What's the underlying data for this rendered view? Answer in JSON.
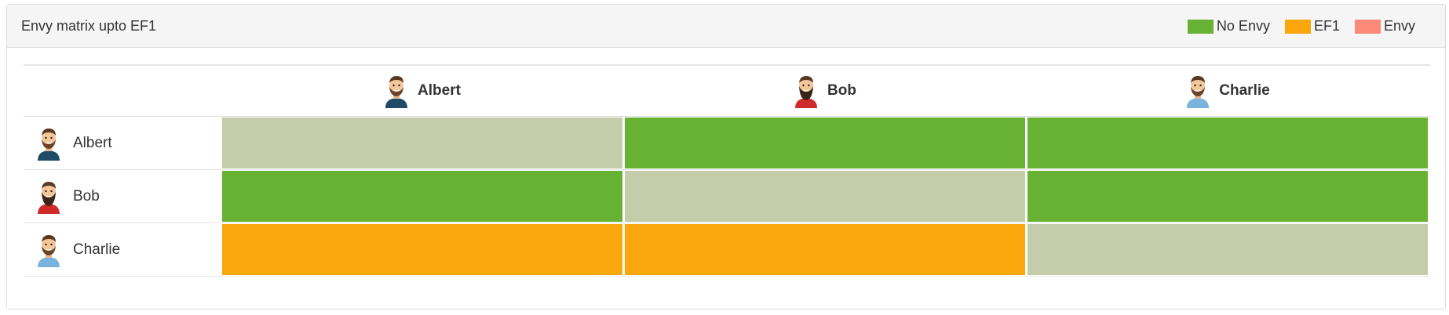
{
  "panel": {
    "title": "Envy matrix upto EF1"
  },
  "legend": [
    {
      "label": "No Envy",
      "color": "#67b133"
    },
    {
      "label": "EF1",
      "color": "#faa70d"
    },
    {
      "label": "Envy",
      "color": "#fb8a7a"
    }
  ],
  "colors": {
    "self": "#c4cca9",
    "no_envy": "#67b133",
    "ef1": "#faa70d",
    "envy": "#fb8a7a"
  },
  "agents": [
    {
      "name": "Albert",
      "avatar": "avatar-albert-icon",
      "shirt": "#1f4a68"
    },
    {
      "name": "Bob",
      "avatar": "avatar-bob-icon",
      "shirt": "#d02b2b"
    },
    {
      "name": "Charlie",
      "avatar": "avatar-charlie-icon",
      "shirt": "#7ab3dd"
    }
  ],
  "matrix": [
    [
      "self",
      "no_envy",
      "no_envy"
    ],
    [
      "no_envy",
      "self",
      "no_envy"
    ],
    [
      "ef1",
      "ef1",
      "self"
    ]
  ]
}
